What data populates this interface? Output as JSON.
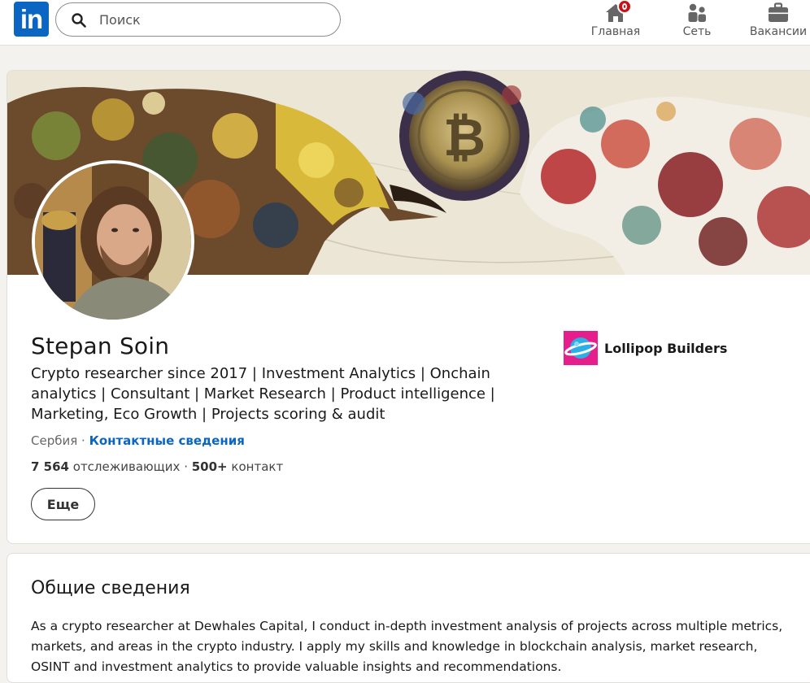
{
  "nav": {
    "logo_text": "in",
    "search": {
      "placeholder": "Поиск",
      "value": ""
    },
    "items": [
      {
        "label": "Главная",
        "icon": "home-icon",
        "has_notification": true
      },
      {
        "label": "Сеть",
        "icon": "people-icon"
      },
      {
        "label": "Вакансии",
        "icon": "briefcase-icon"
      }
    ]
  },
  "profile": {
    "name": "Stepan Soin",
    "headline": "Crypto researcher since 2017 | Investment Analytics | Onchain analytics | Consultant | Market Research | Product intelligence | Marketing, Eco Growth | Projects scoring & audit",
    "location": "Сербия",
    "separator": " · ",
    "contact_link": "Контактные сведения",
    "followers_count": "7 564",
    "followers_label": "отслеживающих",
    "connections_sep": " · ",
    "connections_count": "500+",
    "connections_label": "контакт",
    "more_button": "Еще",
    "company": {
      "name": "Lollipop Builders",
      "logo_icon": "planet-logo-icon"
    },
    "banner": {
      "description_icon": "bull-bitcoin-bear-banner"
    }
  },
  "about": {
    "title": "Общие сведения",
    "text": "As a crypto researcher at Dewhales Capital, I conduct in-depth investment analysis of projects across multiple metrics, markets, and areas in the crypto industry. I apply my skills and knowledge in blockchain analysis, market research, OSINT and investment analytics to provide valuable insights and recommendations."
  },
  "colors": {
    "brand_blue": "#0a66c2",
    "notification_red": "#cc1016",
    "page_bg": "#f3f2ef"
  }
}
